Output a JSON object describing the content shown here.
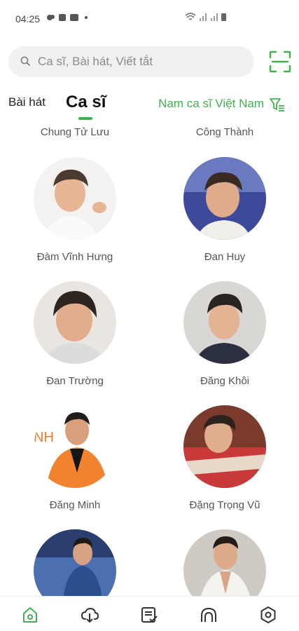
{
  "status_bar": {
    "time": "04:25"
  },
  "search": {
    "placeholder": "Ca sĩ, Bài hát, Viết tắt"
  },
  "tabs": {
    "songs_label": "Bài hát",
    "singers_label": "Ca sĩ"
  },
  "filter": {
    "label": "Nam ca sĩ Việt Nam"
  },
  "singers_cut": [
    "Chung Tử Lưu",
    "Công Thành"
  ],
  "singers": [
    {
      "name": "Đàm Vĩnh Hưng"
    },
    {
      "name": "Đan Huy"
    },
    {
      "name": "Đan Trường"
    },
    {
      "name": "Đăng Khôi"
    },
    {
      "name": "Đăng Minh",
      "badge": "NH"
    },
    {
      "name": "Đặng Trọng Vũ"
    },
    {
      "name": ""
    },
    {
      "name": ""
    }
  ],
  "colors": {
    "accent": "#3fb24f"
  },
  "bottom_nav": [
    "home-icon",
    "cloud-download-icon",
    "playlist-icon",
    "remote-icon",
    "settings-icon"
  ]
}
